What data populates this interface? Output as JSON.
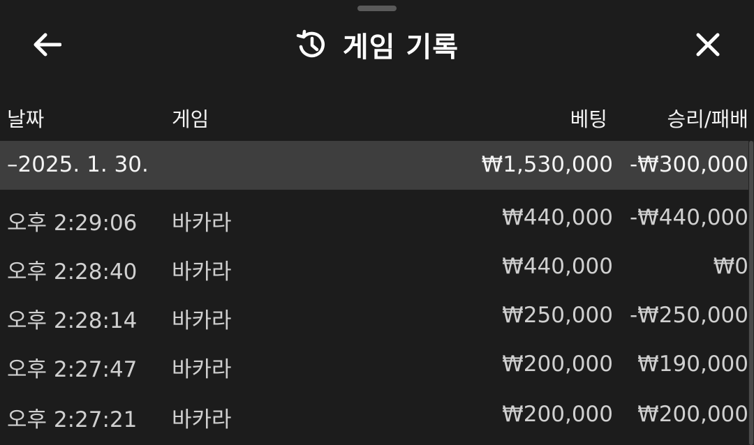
{
  "header": {
    "title": "게임 기록"
  },
  "columns": {
    "date": "날짜",
    "game": "게임",
    "bet": "베팅",
    "result": "승리/패배"
  },
  "group": {
    "toggle": "–",
    "date": "2025. 1. 30.",
    "bet_total": "₩1,530,000",
    "result_total": "-₩300,000"
  },
  "rows": [
    {
      "time": "오후 2:29:06",
      "game": "바카라",
      "bet": "₩440,000",
      "result": "-₩440,000"
    },
    {
      "time": "오후 2:28:40",
      "game": "바카라",
      "bet": "₩440,000",
      "result": "₩0"
    },
    {
      "time": "오후 2:28:14",
      "game": "바카라",
      "bet": "₩250,000",
      "result": "-₩250,000"
    },
    {
      "time": "오후 2:27:47",
      "game": "바카라",
      "bet": "₩200,000",
      "result": "₩190,000"
    },
    {
      "time": "오후 2:27:21",
      "game": "바카라",
      "bet": "₩200,000",
      "result": "₩200,000"
    }
  ],
  "colors": {
    "background": "#1c1c1c",
    "group_row": "#3e3e3e",
    "text_primary": "#ffffff",
    "text_secondary": "#d0d0d0"
  },
  "icons": {
    "back": "arrow-left-icon",
    "history": "history-icon",
    "close": "close-icon"
  }
}
